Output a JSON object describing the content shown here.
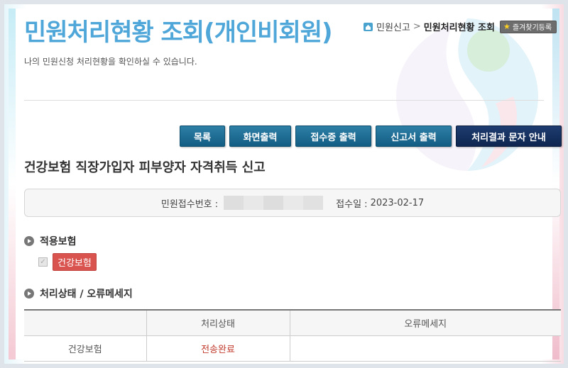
{
  "header": {
    "title": "민원처리현황 조회(개인비회원)",
    "description": "나의 민원신청 처리현황을 확인하실 수 있습니다."
  },
  "breadcrumb": {
    "items": [
      "민원신고",
      "민원처리현황 조회"
    ],
    "separator": ">",
    "favorite_label": "즐겨찾기등록"
  },
  "actions": {
    "list": "목록",
    "print_screen": "화면출력",
    "print_receipt": "접수증 출력",
    "print_report": "신고서 출력",
    "result_sms": "처리결과 문자 안내"
  },
  "document": {
    "title": "건강보험 직장가입자 피부양자 자격취득 신고",
    "receipt_label": "민원접수번호 :",
    "receipt_number_masked": true,
    "receipt_date_label": "접수일 :",
    "receipt_date": "2023-02-17"
  },
  "insurance": {
    "section_title": "적용보험",
    "items": [
      {
        "label": "건강보험",
        "checked": true
      }
    ]
  },
  "status": {
    "section_title": "처리상태 / 오류메세지",
    "columns": [
      "",
      "처리상태",
      "오류메세지"
    ],
    "rows": [
      [
        "건강보험",
        "전송완료",
        ""
      ]
    ]
  },
  "colors": {
    "title": "#4fa6d8",
    "button": "#135d84",
    "button_dark": "#0e2650",
    "tag": "#d9534f",
    "status_ok": "#c0392b"
  }
}
